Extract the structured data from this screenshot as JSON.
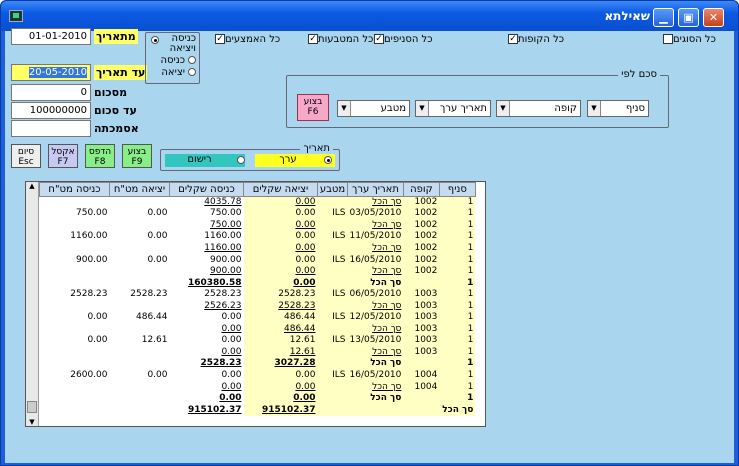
{
  "window": {
    "title": "שאילתא"
  },
  "titlebar": {
    "minimize": "▁",
    "maximize": "▣",
    "close": "✕"
  },
  "form": {
    "from_date_label": "מתאריך",
    "from_date": "01-01-2010",
    "to_date_label": "עד תאריך",
    "to_date": "20-05-2010",
    "from_amount_label": "מסכום",
    "from_amount": "0",
    "to_amount_label": "עד סכום",
    "to_amount": "100000000",
    "reference_label": "אסמכתה",
    "reference": ""
  },
  "direction": {
    "options": [
      "כניסה ויציאה",
      "כניסה",
      "יציאה"
    ],
    "selected": 0
  },
  "checks": [
    {
      "label": "כל האמצעים",
      "checked": true
    },
    {
      "label": "כל המטבעות",
      "checked": true
    },
    {
      "label": "כל הסניפים",
      "checked": true
    },
    {
      "label": "כל הקופות",
      "checked": true
    },
    {
      "label": "כל הסוגים",
      "checked": false
    }
  ],
  "group_by": {
    "title": "סכם לפי",
    "fields": [
      "סניף",
      "קופה",
      "תאריך ערך",
      "מטבע"
    ]
  },
  "buttons": {
    "execute_f6": "בצוע F6",
    "execute_f9": "בצוע F9",
    "print_f8": "הדפס F8",
    "excel_f7": "אקסל F7",
    "exit_esc": "סיום Esc"
  },
  "date_type": {
    "title": "תאריך",
    "value": "ערך",
    "record": "רישום"
  },
  "table": {
    "columns": [
      "סניף",
      "קופה",
      "תאריך ערך",
      "מטבע",
      "יציאה שקלים",
      "כניסה שקלים",
      "יציאה מט\"ח",
      "כניסה מט\"ח"
    ],
    "rows": [
      {
        "c": [
          "1",
          "1002",
          "סך הכל",
          "",
          "0.00",
          "4035.78",
          "",
          ""
        ],
        "t": "sub"
      },
      {
        "c": [
          "1",
          "1002",
          "03/05/2010",
          "ILS",
          "0.00",
          "750.00",
          "0.00",
          "750.00"
        ],
        "t": "row"
      },
      {
        "c": [
          "1",
          "1002",
          "סך הכל",
          "",
          "0.00",
          "750.00",
          "",
          ""
        ],
        "t": "sub"
      },
      {
        "c": [
          "1",
          "1002",
          "11/05/2010",
          "ILS",
          "0.00",
          "1160.00",
          "0.00",
          "1160.00"
        ],
        "t": "row"
      },
      {
        "c": [
          "1",
          "1002",
          "סך הכל",
          "",
          "0.00",
          "1160.00",
          "",
          ""
        ],
        "t": "sub"
      },
      {
        "c": [
          "1",
          "1002",
          "16/05/2010",
          "ILS",
          "0.00",
          "900.00",
          "0.00",
          "900.00"
        ],
        "t": "row"
      },
      {
        "c": [
          "1",
          "1002",
          "סך הכל",
          "",
          "0.00",
          "900.00",
          "",
          ""
        ],
        "t": "sub"
      },
      {
        "c": [
          "1",
          "",
          "סך הכל",
          "",
          "0.00",
          "160380.58",
          "",
          ""
        ],
        "t": "tot"
      },
      {
        "c": [
          "1",
          "1003",
          "06/05/2010",
          "ILS",
          "2528.23",
          "2528.23",
          "2528.23",
          "2528.23"
        ],
        "t": "row"
      },
      {
        "c": [
          "1",
          "1003",
          "סך הכל",
          "",
          "2528.23",
          "2526.23",
          "",
          ""
        ],
        "t": "sub"
      },
      {
        "c": [
          "1",
          "1003",
          "12/05/2010",
          "ILS",
          "486.44",
          "0.00",
          "486.44",
          "0.00"
        ],
        "t": "row"
      },
      {
        "c": [
          "1",
          "1003",
          "סך הכל",
          "",
          "486.44",
          "0.00",
          "",
          ""
        ],
        "t": "sub"
      },
      {
        "c": [
          "1",
          "1003",
          "13/05/2010",
          "ILS",
          "12.61",
          "0.00",
          "12.61",
          "0.00"
        ],
        "t": "row"
      },
      {
        "c": [
          "1",
          "1003",
          "סך הכל",
          "",
          "12.61",
          "0.00",
          "",
          ""
        ],
        "t": "sub"
      },
      {
        "c": [
          "1",
          "",
          "סך הכל",
          "",
          "3027.28",
          "2528.23",
          "",
          ""
        ],
        "t": "tot"
      },
      {
        "c": [
          "1",
          "1004",
          "16/05/2010",
          "ILS",
          "0.00",
          "0.00",
          "0.00",
          "2600.00"
        ],
        "t": "row"
      },
      {
        "c": [
          "1",
          "1004",
          "סך הכל",
          "",
          "0.00",
          "0.00",
          "",
          ""
        ],
        "t": "sub"
      },
      {
        "c": [
          "1",
          "",
          "סך הכל",
          "",
          "0.00",
          "0.00",
          "",
          ""
        ],
        "t": "tot"
      },
      {
        "c": [
          "סך הכל",
          "",
          "",
          "",
          "915102.37",
          "915102.37",
          "",
          ""
        ],
        "t": "tot"
      }
    ]
  }
}
